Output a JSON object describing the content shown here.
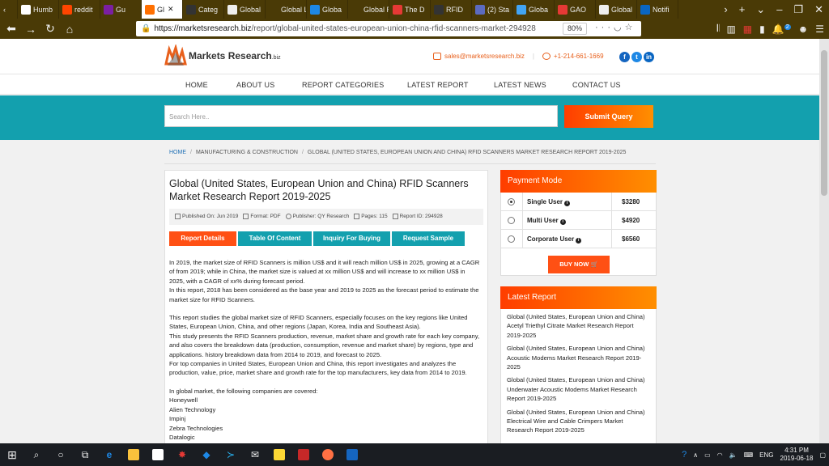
{
  "browser": {
    "tabs": [
      {
        "label": "Humb",
        "color": "#ffffff",
        "active": false
      },
      {
        "label": "reddit",
        "color": "#ff4500",
        "active": false
      },
      {
        "label": "Gu",
        "color": "#7b1fa2",
        "active": false
      },
      {
        "label": "Gl",
        "color": "#ff6f00",
        "active": true
      },
      {
        "label": "Categ",
        "color": "#333333",
        "active": false
      },
      {
        "label": "Global",
        "color": "#eeeeee",
        "active": false
      },
      {
        "label": "Global Lig",
        "color": "#4a3a06",
        "active": false
      },
      {
        "label": "Globa",
        "color": "#1e88e5",
        "active": false
      },
      {
        "label": "Global Ra",
        "color": "#4a3a06",
        "active": false
      },
      {
        "label": "The D",
        "color": "#e53935",
        "active": false
      },
      {
        "label": "RFID",
        "color": "#333333",
        "active": false
      },
      {
        "label": "(2) Sta",
        "color": "#5c6bc0",
        "active": false
      },
      {
        "label": "Globa",
        "color": "#42a5f5",
        "active": false
      },
      {
        "label": "GAO",
        "color": "#e53935",
        "active": false
      },
      {
        "label": "Global",
        "color": "#eeeeee",
        "active": false
      },
      {
        "label": "Notifi",
        "color": "#0a66c2",
        "active": false
      }
    ],
    "url_host": "https://marketsresearch.biz",
    "url_path": "/report/global-united-states-european-union-china-rfid-scanners-market-294928",
    "zoom": "80%",
    "notification_count": "2"
  },
  "site": {
    "logo_text": "Markets Research",
    "logo_suffix": ".biz",
    "email": "sales@marketsresearch.biz",
    "phone": "+1-214-661-1669",
    "nav": [
      "HOME",
      "ABOUT US",
      "REPORT CATEGORIES",
      "LATEST REPORT",
      "LATEST NEWS",
      "CONTACT US"
    ],
    "search_placeholder": "Search Here..",
    "submit_label": "Submit Query"
  },
  "breadcrumb": {
    "home": "HOME",
    "category": "MANUFACTURING & CONSTRUCTION",
    "current": "GLOBAL (UNITED STATES, EUROPEAN UNION AND CHINA) RFID SCANNERS MARKET RESEARCH REPORT 2019-2025"
  },
  "report": {
    "title": "Global (United States, European Union and China) RFID Scanners Market Research Report 2019-2025",
    "published": "Published On: Jun 2019",
    "format": "Format: PDF",
    "publisher": "Publisher: QY Research",
    "pages": "Pages: 115",
    "report_id": "Report ID: 294928",
    "tabs": [
      "Report Details",
      "Table Of Content",
      "Inquiry For Buying",
      "Request Sample"
    ],
    "para1": "In 2019, the market size of RFID Scanners is million US$ and it will reach million US$ in 2025, growing at a CAGR of from 2019; while in China, the market size is valued at xx million US$ and will increase to xx million US$ in 2025, with a CAGR of xx% during forecast period.",
    "para2": "In this report, 2018 has been considered as the base year and 2019 to 2025 as the forecast period to estimate the market size for RFID Scanners.",
    "para3": "This report studies the global market size of RFID Scanners, especially focuses on the key regions like United States, European Union, China, and other regions (Japan, Korea, India and Southeast Asia).",
    "para4": "This study presents the RFID Scanners production, revenue, market share and growth rate for each key company, and also covers the breakdown data (production, consumption, revenue and market share) by regions, type and applications. history breakdown data from 2014 to 2019, and forecast to 2025.",
    "para5": "For top companies in United States, European Union and China, this report investigates and analyzes the production, value, price, market share and growth rate for the top manufacturers, key data from 2014 to 2019.",
    "para6": "In global market, the following companies are covered:",
    "companies": [
      "Honeywell",
      "Alien Technology",
      "Impinj",
      "Zebra Technologies",
      "Datalogic"
    ]
  },
  "payment": {
    "heading": "Payment Mode",
    "options": [
      {
        "label": "Single User",
        "price": "$3280",
        "selected": true
      },
      {
        "label": "Multi User",
        "price": "$4920",
        "selected": false
      },
      {
        "label": "Corporate User",
        "price": "$6560",
        "selected": false
      }
    ],
    "buy_label": "BUY NOW"
  },
  "latest_report": {
    "heading": "Latest Report",
    "items": [
      "Global (United States, European Union and China) Acetyl Triethyl Citrate Market Research Report 2019-2025",
      "Global (United States, European Union and China) Acoustic Modems Market Research Report 2019-2025",
      "Global (United States, European Union and China) Underwater Acoustic Modems Market Research Report 2019-2025",
      "Global (United States, European Union and China) Electrical Wire and Cable Crimpers Market Research Report 2019-2025"
    ]
  },
  "taskbar": {
    "language": "ENG",
    "time": "4:31 PM",
    "date": "2019-06-18"
  }
}
